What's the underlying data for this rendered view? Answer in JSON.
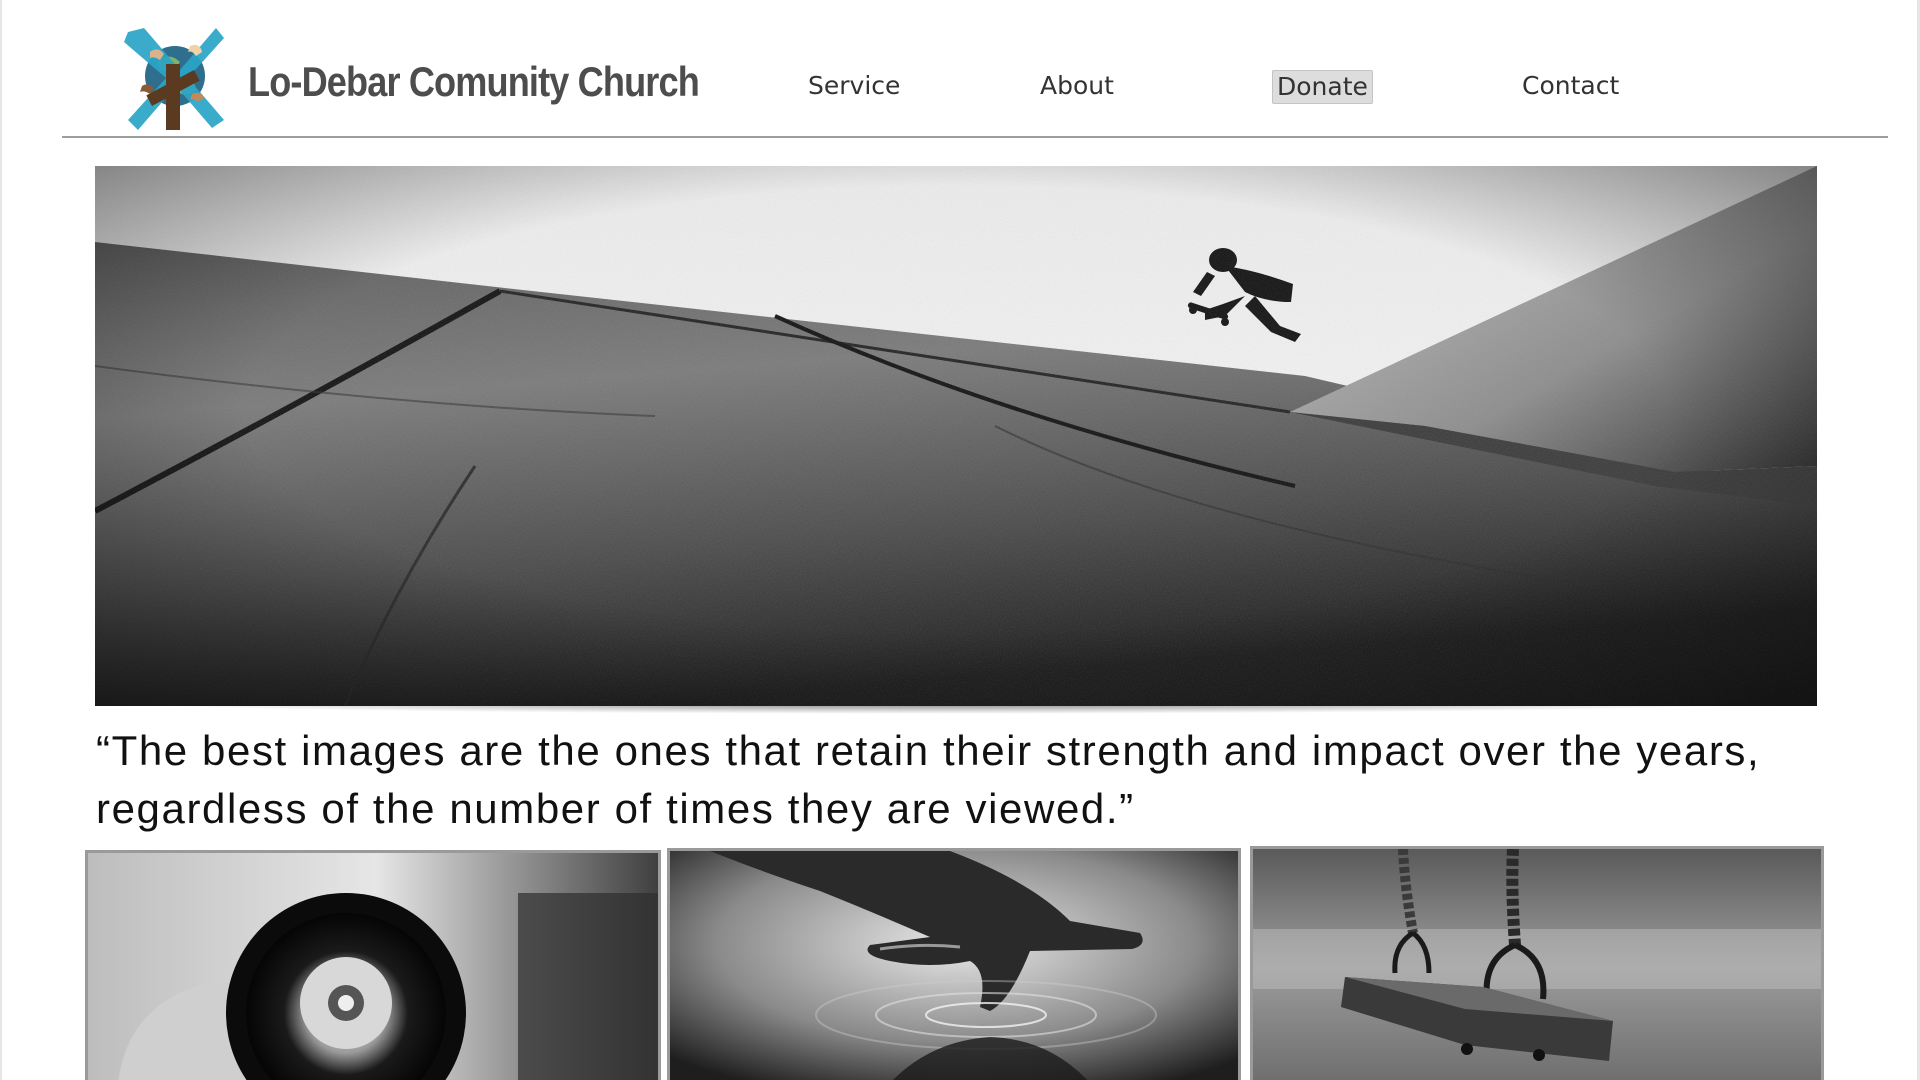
{
  "brand": {
    "name": "Lo-Debar Comunity Church",
    "logo_icon": "church-hands-globe-cross-logo"
  },
  "nav": {
    "items": [
      {
        "label": "Service"
      },
      {
        "label": "About"
      },
      {
        "label": "Donate",
        "active": true
      },
      {
        "label": "Contact"
      }
    ]
  },
  "hero": {
    "image": "skateboarder-on-concrete-ramp-photo"
  },
  "quote": {
    "text": "“The best images are the ones that retain their strength and impact over the years, regardless of the number of times they are viewed.”"
  },
  "gallery": {
    "items": [
      {
        "image": "camera-lens-in-hand-photo"
      },
      {
        "image": "finger-touching-water-photo"
      },
      {
        "image": "wooden-swing-photo"
      }
    ]
  },
  "colors": {
    "text": "#333333",
    "brand_text": "#4d4d4d",
    "logo_blue": "#2aa4c8",
    "logo_brown": "#6b4a2e",
    "rule": "#9e9e9e",
    "donate_bg": "#dddddd"
  }
}
